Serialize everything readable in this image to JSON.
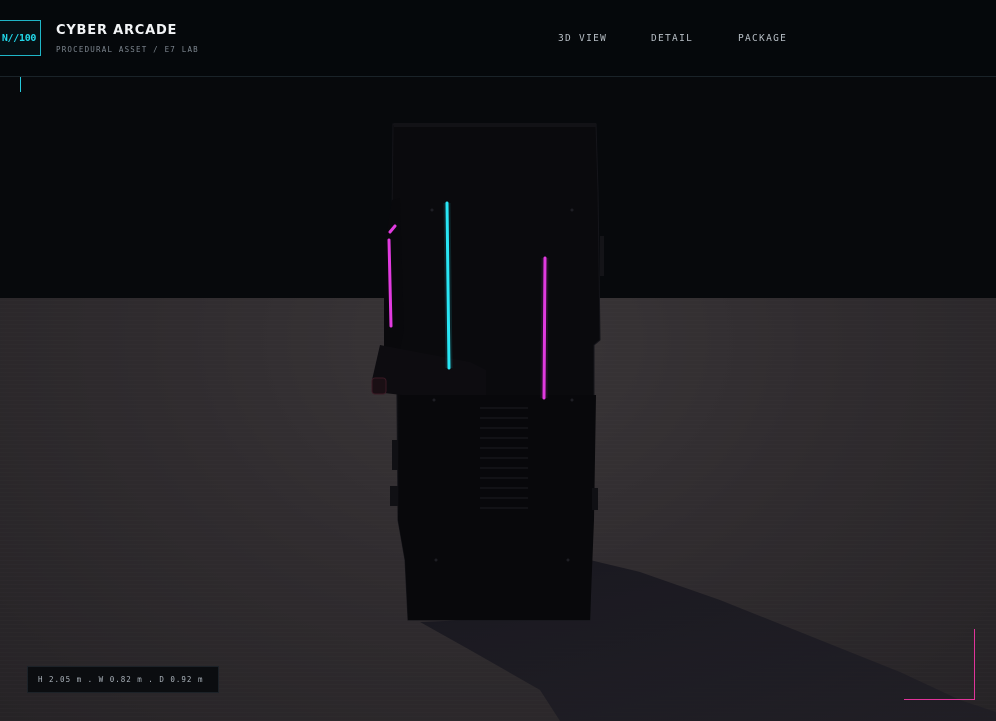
{
  "header": {
    "logo_text": "N//100",
    "title": "CYBER ARCADE",
    "subtitle": "PROCEDURAL ASSET / E7 LAB",
    "nav": [
      {
        "label": "3D VIEW"
      },
      {
        "label": "DETAIL"
      },
      {
        "label": "PACKAGE"
      }
    ]
  },
  "viewport": {
    "dimensions_text": "H 2.05 m . W 0.82 m . D 0.92 m",
    "neon_colors": {
      "cyan": "#29e6f5",
      "magenta": "#e23be0"
    },
    "corner_accent_color": "#e0349a",
    "tick_accent_color": "#26c9dc"
  }
}
